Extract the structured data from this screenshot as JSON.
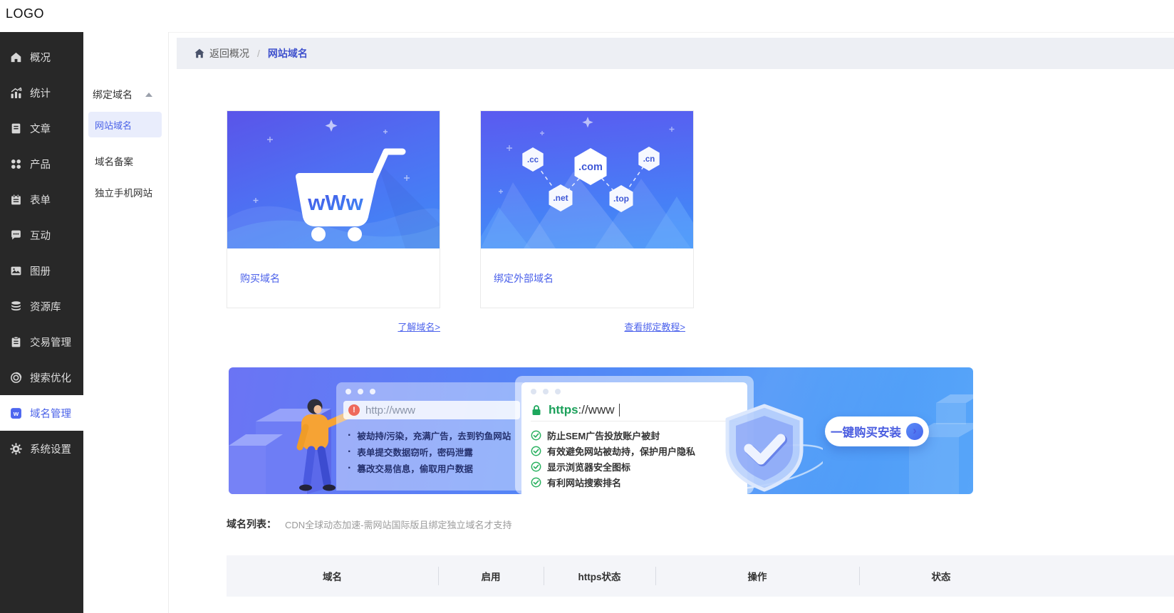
{
  "topbar": {
    "logo": "LOGO"
  },
  "sidebar": {
    "items": [
      {
        "label": "概况",
        "icon": "home-icon"
      },
      {
        "label": "统计",
        "icon": "stats-icon"
      },
      {
        "label": "文章",
        "icon": "article-icon"
      },
      {
        "label": "产品",
        "icon": "product-icon"
      },
      {
        "label": "表单",
        "icon": "form-icon"
      },
      {
        "label": "互动",
        "icon": "interact-icon"
      },
      {
        "label": "图册",
        "icon": "gallery-icon"
      },
      {
        "label": "资源库",
        "icon": "resource-icon"
      },
      {
        "label": "交易管理",
        "icon": "trade-icon"
      },
      {
        "label": "搜索优化",
        "icon": "seo-icon"
      },
      {
        "label": "域名管理",
        "icon": "domain-icon",
        "icon_glyph": "w",
        "active": true
      },
      {
        "label": "系统设置",
        "icon": "settings-icon"
      }
    ]
  },
  "subsidebar": {
    "group_label": "绑定域名",
    "items": [
      {
        "label": "网站域名",
        "active": true
      },
      {
        "label": "域名备案"
      },
      {
        "label": "独立手机网站"
      }
    ]
  },
  "breadcrumb": {
    "back_label": "返回概况",
    "separator": "/",
    "current": "网站域名"
  },
  "cards": {
    "purchase": {
      "title": "购买域名",
      "link": "了解域名>",
      "cart_text": "wWw"
    },
    "bind_external": {
      "title": "绑定外部域名",
      "link": "查看绑定教程>",
      "hexagons": [
        ".cc",
        ".com",
        ".cn",
        ".net",
        ".top"
      ]
    }
  },
  "banner": {
    "http_panel": {
      "url": "http://www",
      "alert_glyph": "!",
      "bullet": "·",
      "risks": [
        "被劫持/污染，充满广告，去到钓鱼网站",
        "表单提交数据窃听，密码泄露",
        "篡改交易信息，偷取用户数据"
      ]
    },
    "https_panel": {
      "scheme": "https",
      "rest": "://www",
      "benefits": [
        "防止SEM广告投放账户被封",
        "有效避免网站被劫持，保护用户隐私",
        "显示浏览器安全图标",
        "有利网站搜索排名"
      ]
    },
    "cta_label": "一键购买安装",
    "cta_arrow": "›"
  },
  "domain_list": {
    "label": "域名列表：",
    "hint": "CDN全球动态加速-需网站国际版且绑定独立域名才支持"
  },
  "table": {
    "columns": [
      "域名",
      "启用",
      "https状态",
      "操作",
      "状态"
    ]
  },
  "colors": {
    "accent": "#4a62e8",
    "sidebar_bg": "#282828",
    "breadcrumb_bg": "#edeff4",
    "table_header_bg": "#f4f5f9",
    "green": "#22ad5f",
    "red": "#ee6a5c",
    "banner_blue_start": "#6b74f4",
    "banner_blue_end": "#4d9af8"
  }
}
